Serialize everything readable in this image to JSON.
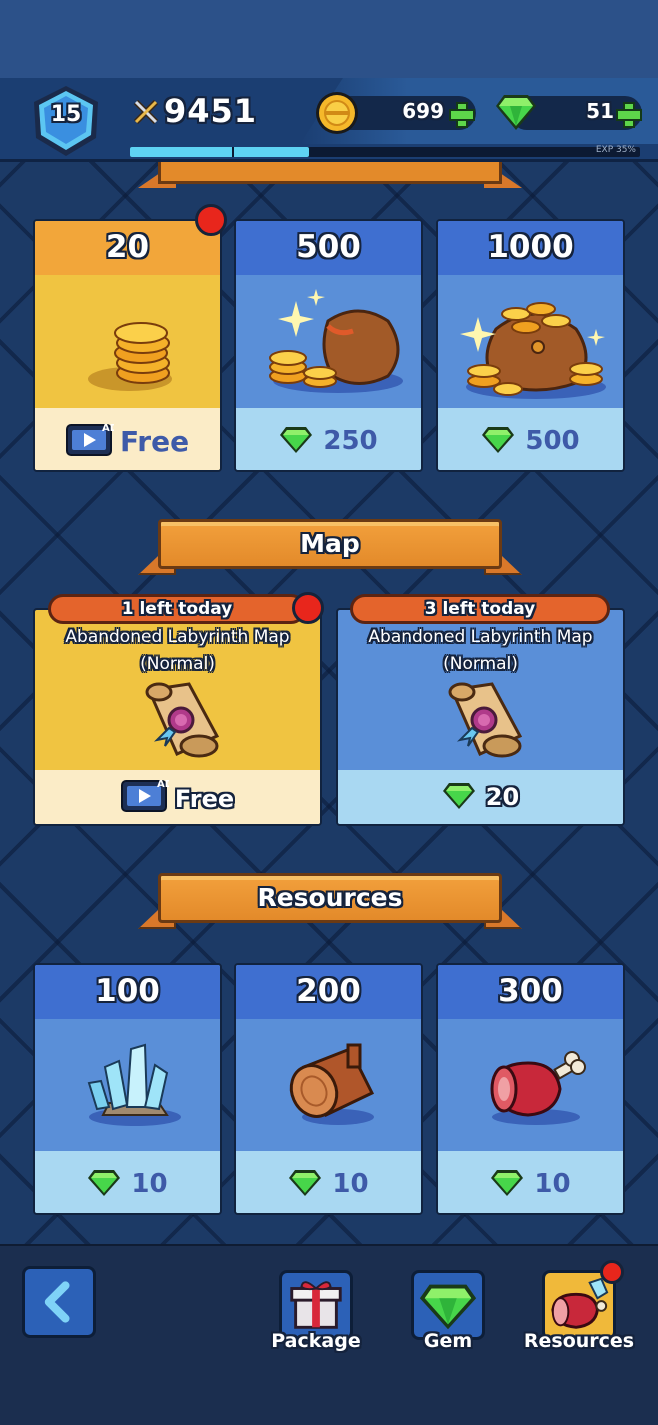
{
  "hud": {
    "level": "15",
    "power": "9451",
    "coins": "699",
    "gems": "51",
    "exp_label": "EXP 35%",
    "exp_progress": 0.35
  },
  "gold_section": {
    "cards": [
      {
        "amount": "20",
        "price": "Free",
        "ad_badge": "AD",
        "payment": "ad",
        "has_notification": true
      },
      {
        "amount": "500",
        "price": "250",
        "payment": "gem"
      },
      {
        "amount": "1000",
        "price": "500",
        "payment": "gem"
      }
    ]
  },
  "map_section": {
    "title": "Map",
    "cards": [
      {
        "limit": "1 left today",
        "name_line1": "Abandoned Labyrinth Map",
        "name_line2": "(Normal)",
        "price": "Free",
        "ad_badge": "AD",
        "payment": "ad",
        "has_notification": true
      },
      {
        "limit": "3 left today",
        "name_line1": "Abandoned Labyrinth Map",
        "name_line2": "(Normal)",
        "price": "20",
        "payment": "gem"
      }
    ]
  },
  "resources_section": {
    "title": "Resources",
    "cards": [
      {
        "amount": "100",
        "item": "crystal-icon",
        "price": "10"
      },
      {
        "amount": "200",
        "item": "wood-log-icon",
        "price": "10"
      },
      {
        "amount": "300",
        "item": "meat-icon",
        "price": "10"
      }
    ]
  },
  "bottom_nav": {
    "tabs": [
      {
        "label": "Package",
        "icon": "gift-box-icon"
      },
      {
        "label": "Gem",
        "icon": "gem-icon"
      },
      {
        "label": "Resources",
        "icon": "resources-icon",
        "active": true,
        "has_notification": true
      }
    ]
  },
  "colors": {
    "background": "#1c3a66",
    "card_blue": "#5a8fd8",
    "card_gold": "#f0c441",
    "banner": "#e38a2a",
    "notification": "#e8261c",
    "price_text": "#3e5aa8"
  }
}
